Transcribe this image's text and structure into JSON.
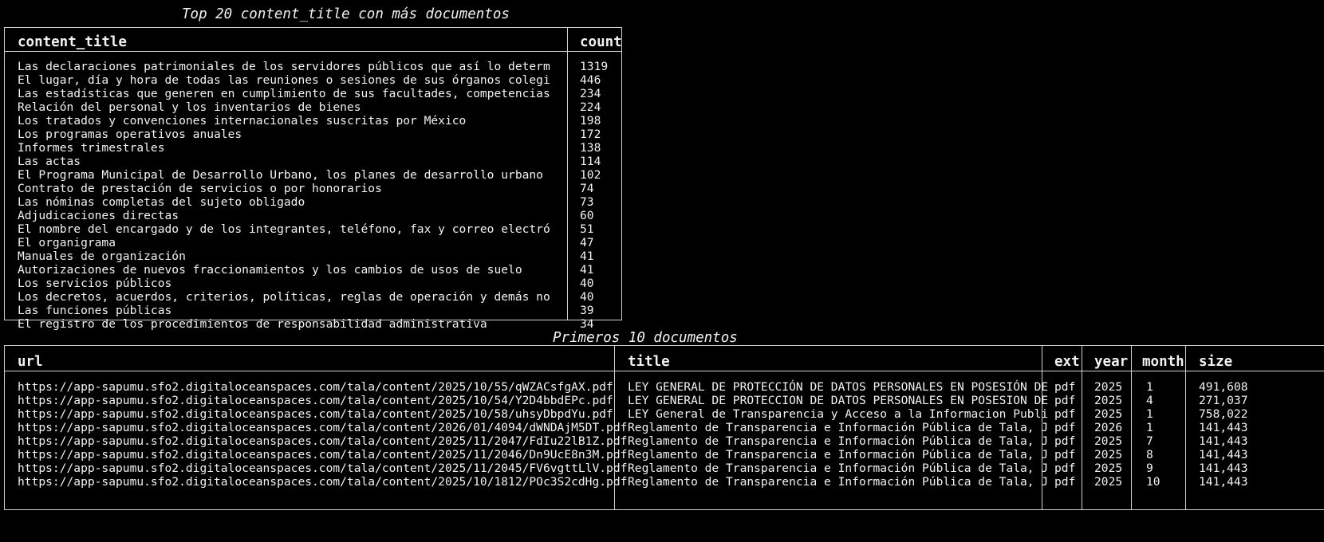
{
  "top_table": {
    "title": "Top 20 content_title con más documentos",
    "headers": [
      "content_title",
      "count"
    ],
    "rows": [
      [
        "Las declaraciones patrimoniales de los servidores públicos que así lo determ",
        "1319"
      ],
      [
        "El lugar, día y hora de todas las reuniones o sesiones de sus órganos colegi",
        "446"
      ],
      [
        "Las estadísticas que generen en cumplimiento de sus facultades, competencias",
        "234"
      ],
      [
        "Relación del personal y los inventarios de bienes",
        "224"
      ],
      [
        "Los tratados y convenciones internacionales suscritas por México",
        "198"
      ],
      [
        "Los programas operativos anuales",
        "172"
      ],
      [
        "Informes trimestrales",
        "138"
      ],
      [
        "Las actas",
        "114"
      ],
      [
        "El Programa Municipal de Desarrollo Urbano, los planes de desarrollo urbano",
        "102"
      ],
      [
        "Contrato de prestación de servicios o por honorarios",
        "74"
      ],
      [
        "Las nóminas completas del sujeto obligado",
        "73"
      ],
      [
        "Adjudicaciones directas",
        "60"
      ],
      [
        "El nombre del encargado y de los integrantes, teléfono, fax y correo electró",
        "51"
      ],
      [
        "El organigrama",
        "47"
      ],
      [
        "Manuales de organización",
        "41"
      ],
      [
        "Autorizaciones de nuevos fraccionamientos y los cambios de usos de suelo",
        "41"
      ],
      [
        "Los servicios públicos",
        "40"
      ],
      [
        "Los decretos, acuerdos, criterios, políticas, reglas de operación y demás no",
        "40"
      ],
      [
        "Las funciones públicas",
        "39"
      ],
      [
        "El registro de los procedimientos de responsabilidad administrativa",
        "34"
      ]
    ]
  },
  "docs_table": {
    "title": "Primeros 10 documentos",
    "headers": [
      "url",
      "title",
      "ext",
      "year",
      "month",
      "size"
    ],
    "rows": [
      [
        "https://app-sapumu.sfo2.digitaloceanspaces.com/tala/content/2025/10/55/qWZACsfgAX.pdf",
        "LEY GENERAL DE PROTECCIÓN DE DATOS PERSONALES EN POSESIÓN DE",
        "pdf",
        "2025",
        "1",
        "491,608"
      ],
      [
        "https://app-sapumu.sfo2.digitaloceanspaces.com/tala/content/2025/10/54/Y2D4bbdEPc.pdf",
        "LEY GENERAL DE PROTECCION DE DATOS PERSONALES EN POSESION DE",
        "pdf",
        "2025",
        "4",
        "271,037"
      ],
      [
        "https://app-sapumu.sfo2.digitaloceanspaces.com/tala/content/2025/10/58/uhsyDbpdYu.pdf",
        "LEY General de Transparencia y Acceso a la Informacion Publi",
        "pdf",
        "2025",
        "1",
        "758,022"
      ],
      [
        "https://app-sapumu.sfo2.digitaloceanspaces.com/tala/content/2026/01/4094/dWNDAjM5DT.pdf",
        "Reglamento de Transparencia e Información Pública de Tala, J",
        "pdf",
        "2026",
        "1",
        "141,443"
      ],
      [
        "https://app-sapumu.sfo2.digitaloceanspaces.com/tala/content/2025/11/2047/FdIu22lB1Z.pdf",
        "Reglamento de Transparencia e Información Pública de Tala, J",
        "pdf",
        "2025",
        "7",
        "141,443"
      ],
      [
        "https://app-sapumu.sfo2.digitaloceanspaces.com/tala/content/2025/11/2046/Dn9UcE8n3M.pdf",
        "Reglamento de Transparencia e Información Pública de Tala, J",
        "pdf",
        "2025",
        "8",
        "141,443"
      ],
      [
        "https://app-sapumu.sfo2.digitaloceanspaces.com/tala/content/2025/11/2045/FV6vgttLlV.pdf",
        "Reglamento de Transparencia e Información Pública de Tala, J",
        "pdf",
        "2025",
        "9",
        "141,443"
      ],
      [
        "https://app-sapumu.sfo2.digitaloceanspaces.com/tala/content/2025/10/1812/POc3S2cdHg.pdf",
        "Reglamento de Transparencia e Información Pública de Tala, J",
        "pdf",
        "2025",
        "10",
        "141,443"
      ]
    ]
  }
}
